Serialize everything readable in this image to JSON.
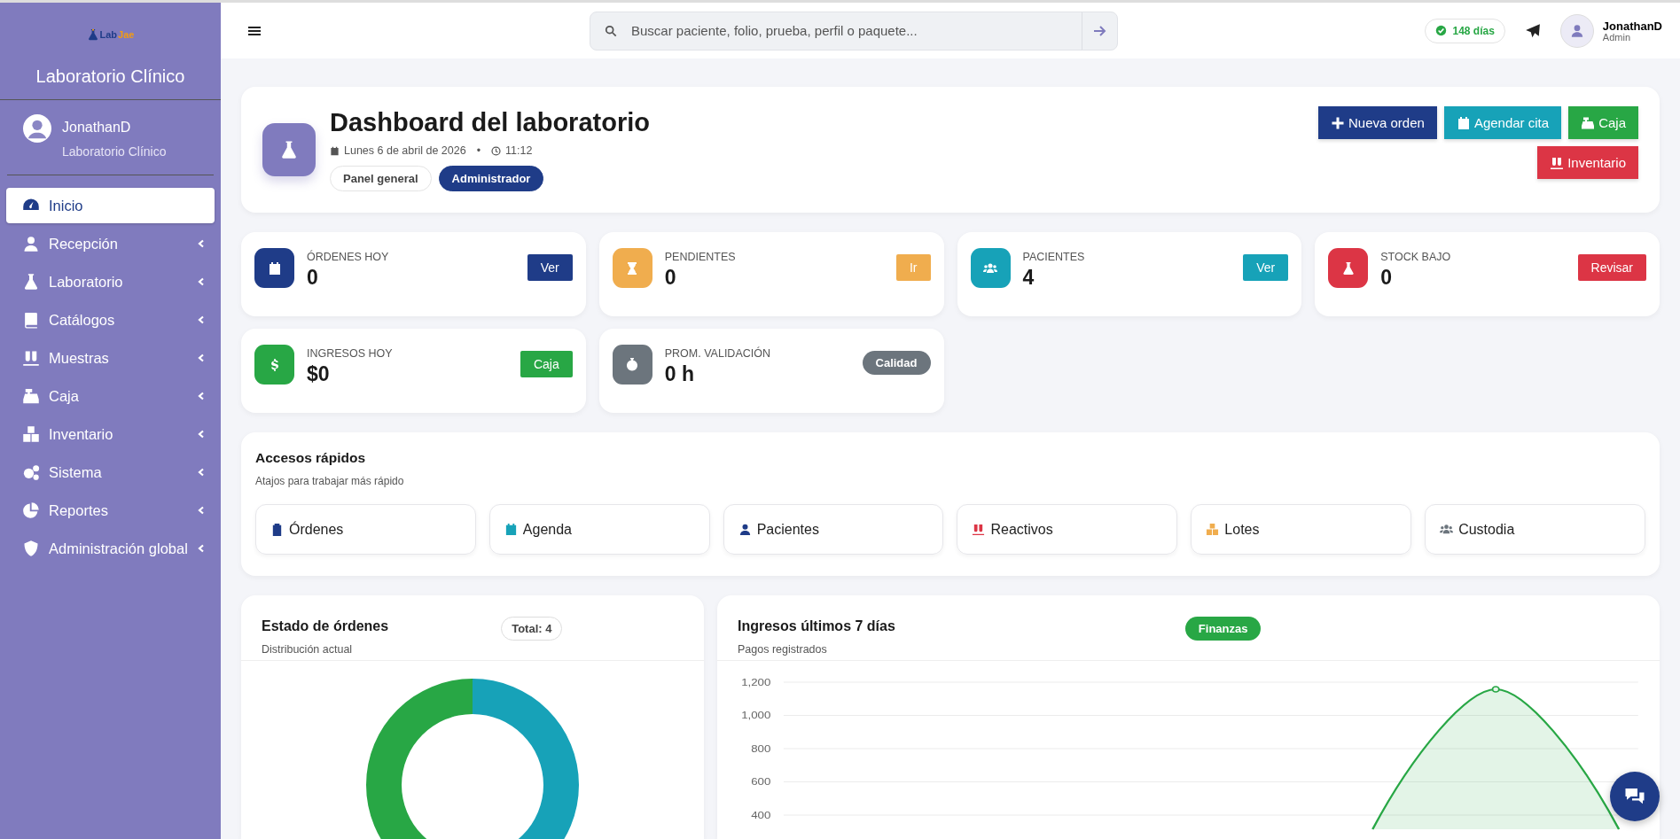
{
  "sidebar": {
    "logo": [
      "Lab",
      "Jae"
    ],
    "title": "Laboratorio Clínico",
    "user": {
      "name": "JonathanD",
      "subtitle": "Laboratorio Clínico"
    },
    "items": [
      {
        "label": "Inicio",
        "kind": "link",
        "selected": true
      },
      {
        "label": "Recepción",
        "kind": "group",
        "selected": false
      },
      {
        "label": "Laboratorio",
        "kind": "group",
        "selected": false
      },
      {
        "label": "Catálogos",
        "kind": "group",
        "selected": false
      },
      {
        "label": "Muestras",
        "kind": "group",
        "selected": false
      },
      {
        "label": "Caja",
        "kind": "group",
        "selected": false
      },
      {
        "label": "Inventario",
        "kind": "group",
        "selected": false
      },
      {
        "label": "Sistema",
        "kind": "group",
        "selected": false
      },
      {
        "label": "Reportes",
        "kind": "group",
        "selected": false
      },
      {
        "label": "Administración global",
        "kind": "group",
        "selected": false
      }
    ]
  },
  "header": {
    "search": {
      "placeholder": "Buscar paciente, folio, prueba, perfil o paquete..."
    },
    "license_badge": "148 días",
    "user": {
      "name": "JonathanD",
      "role": "Admin"
    }
  },
  "dashboard": {
    "title": "Dashboard del laboratorio",
    "date": "Lunes 6 de abril de 2026",
    "separator": "•",
    "time": "11:12",
    "tags": [
      {
        "label": "Panel general",
        "selected": false
      },
      {
        "label": "Administrador",
        "selected": true
      }
    ],
    "actions": [
      {
        "label": "Nueva orden",
        "color": "#1f3c88"
      },
      {
        "label": "Agendar cita",
        "color": "#17a2b8"
      },
      {
        "label": "Caja",
        "color": "#28a745"
      },
      {
        "label": "Inventario",
        "color": "#dc3545"
      }
    ]
  },
  "stats": [
    {
      "label": "ÓRDENES HOY",
      "value": "0",
      "button": "Ver",
      "color": "#1f3c88",
      "kind": "square"
    },
    {
      "label": "PENDIENTES",
      "value": "0",
      "button": "Ir",
      "color": "#f0ad4e",
      "kind": "square"
    },
    {
      "label": "PACIENTES",
      "value": "4",
      "button": "Ver",
      "color": "#17a2b8",
      "kind": "square"
    },
    {
      "label": "STOCK BAJO",
      "value": "0",
      "button": "Revisar",
      "color": "#dc3545",
      "kind": "square"
    },
    {
      "label": "INGRESOS HOY",
      "value": "$0",
      "button": "Caja",
      "color": "#28a745",
      "kind": "square"
    },
    {
      "label": "PROM. VALIDACIÓN",
      "value": "0 h",
      "button": "Calidad",
      "color": "#6c757d",
      "kind": "pill"
    }
  ],
  "quick_access": {
    "title": "Accesos rápidos",
    "subtitle": "Atajos para trabajar más rápido",
    "items": [
      {
        "label": "Órdenes",
        "color": "#1f3c88"
      },
      {
        "label": "Agenda",
        "color": "#17a2b8"
      },
      {
        "label": "Pacientes",
        "color": "#1f3c88"
      },
      {
        "label": "Reactivos",
        "color": "#dc3545"
      },
      {
        "label": "Lotes",
        "color": "#f0ad4e"
      },
      {
        "label": "Custodia",
        "color": "#6c757d"
      }
    ]
  },
  "orders_chart": {
    "title": "Estado de órdenes",
    "subtitle": "Distribución actual",
    "badge": "Total: 4"
  },
  "income_chart": {
    "title": "Ingresos últimos 7 días",
    "subtitle": "Pagos registrados",
    "badge": "Finanzas",
    "y_axis_labels": [
      "1,200",
      "1,000",
      "800",
      "600",
      "400"
    ]
  }
}
